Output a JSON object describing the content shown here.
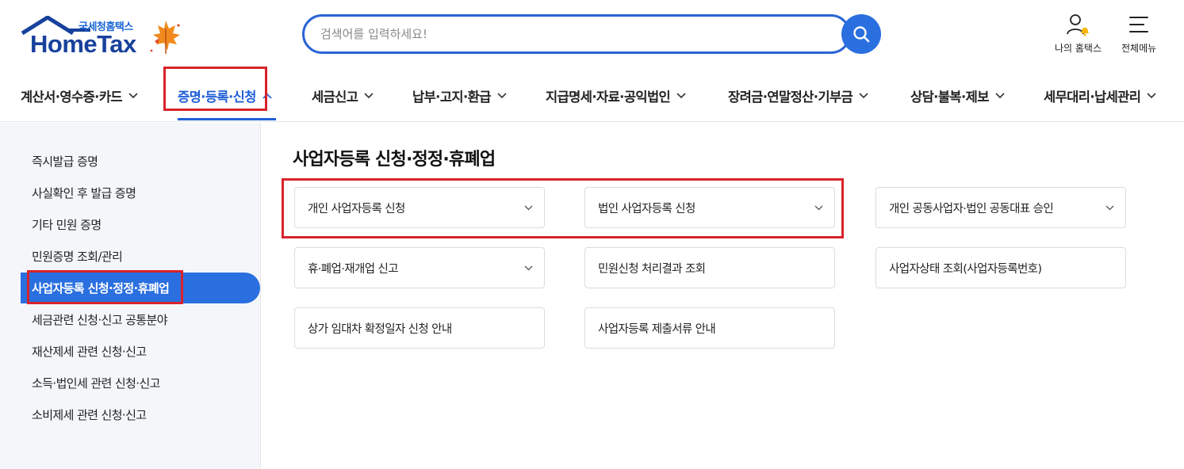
{
  "header": {
    "logo_sub": "국세청홈택스",
    "logo_main": "HomeTax",
    "search_placeholder": "검색어를 입력하세요!",
    "my_hometax": "나의 홈택스",
    "all_menu": "전체메뉴"
  },
  "gnb": {
    "items": [
      {
        "label": "계산서·영수증·카드"
      },
      {
        "label": "증명·등록·신청"
      },
      {
        "label": "세금신고"
      },
      {
        "label": "납부·고지·환급"
      },
      {
        "label": "지급명세·자료·공익법인"
      },
      {
        "label": "장려금·연말정산·기부금"
      },
      {
        "label": "상담·불복·제보"
      },
      {
        "label": "세무대리·납세관리"
      }
    ],
    "active_index": 1
  },
  "sidebar": {
    "items": [
      {
        "label": "즉시발급 증명"
      },
      {
        "label": "사실확인 후 발급 증명"
      },
      {
        "label": "기타 민원 증명"
      },
      {
        "label": "민원증명 조회/관리"
      },
      {
        "label": "사업자등록 신청·정정·휴폐업"
      },
      {
        "label": "세금관련 신청·신고 공통분야"
      },
      {
        "label": "재산제세 관련 신청·신고"
      },
      {
        "label": "소득·법인세 관련 신청·신고"
      },
      {
        "label": "소비제세 관련 신청·신고"
      }
    ],
    "active_index": 4
  },
  "main": {
    "title": "사업자등록 신청·정정·휴폐업",
    "cards": [
      {
        "label": "개인 사업자등록 신청"
      },
      {
        "label": "법인 사업자등록 신청"
      },
      {
        "label": "개인 공동사업자·법인 공동대표 승인"
      },
      {
        "label": "휴·폐업·재개업 신고"
      },
      {
        "label": "민원신청 처리결과 조회"
      },
      {
        "label": "사업자상태 조회(사업자등록번호)"
      },
      {
        "label": "상가 임대차 확정일자 신청 안내"
      },
      {
        "label": "사업자등록 제출서류 안내"
      }
    ]
  },
  "colors": {
    "brand_blue": "#2a6fe0",
    "logo_navy": "#17419c",
    "highlight_red": "#d9222a",
    "sidebar_bg": "#f4f6f9"
  }
}
